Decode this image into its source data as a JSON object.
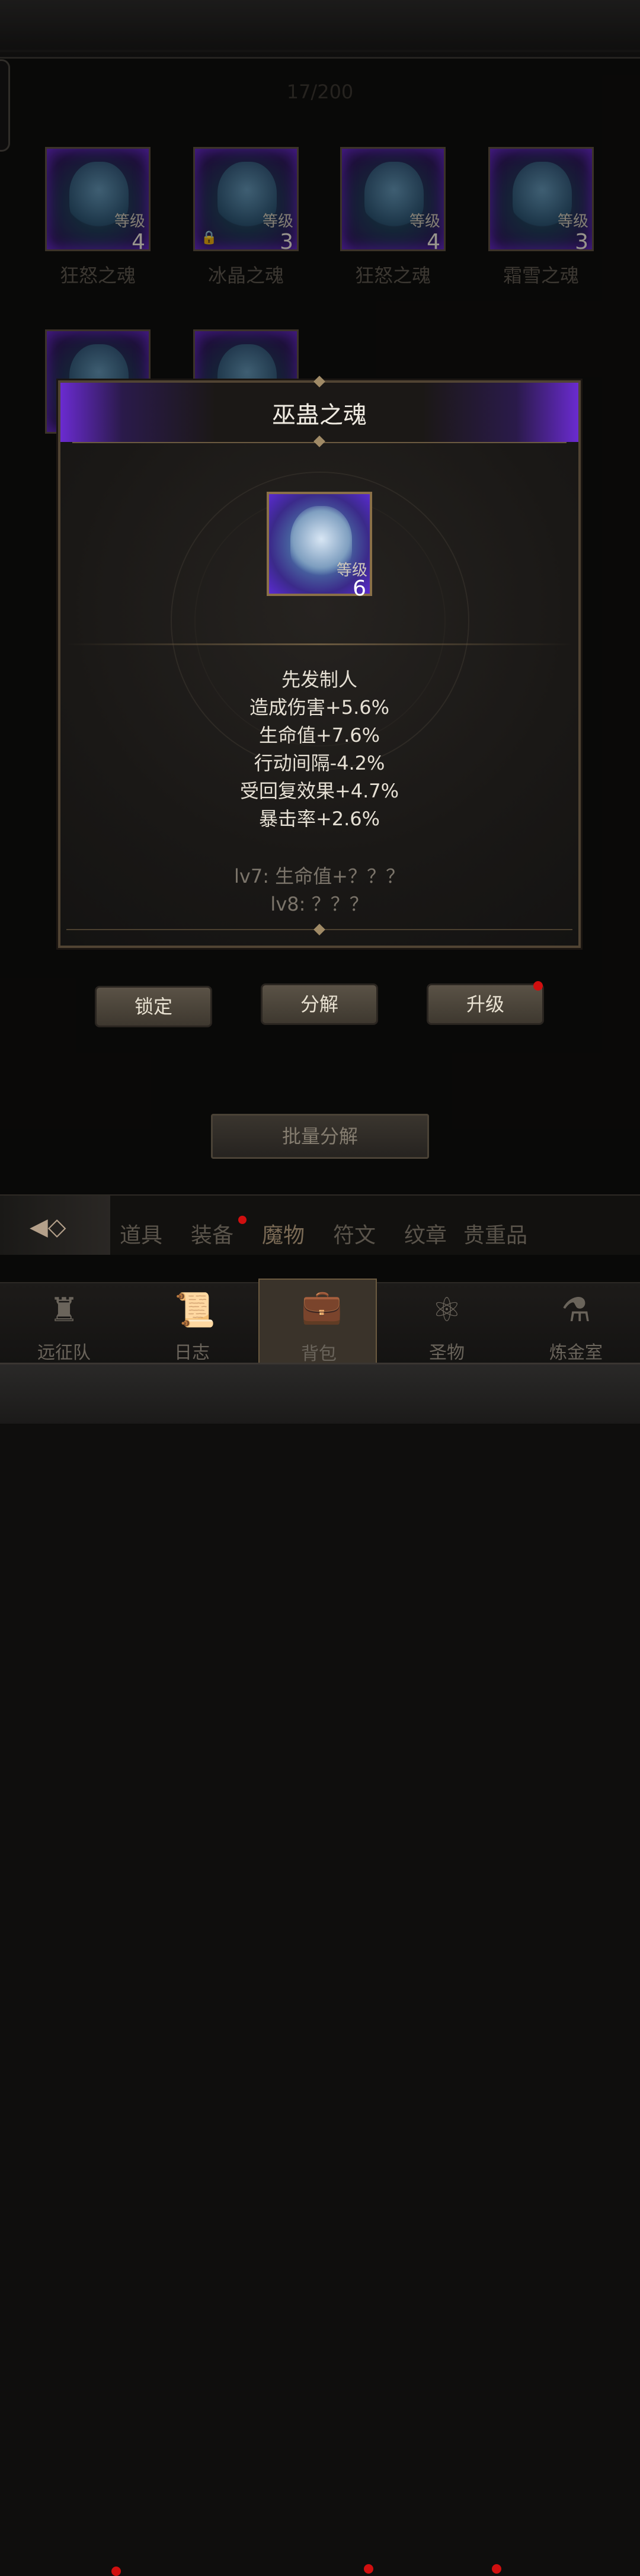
{
  "counter": "17/200",
  "grid": {
    "level_label": "等级",
    "slots": [
      {
        "name": "狂怒之魂",
        "level": "4",
        "locked": false
      },
      {
        "name": "冰晶之魂",
        "level": "3",
        "locked": true
      },
      {
        "name": "狂怒之魂",
        "level": "4",
        "locked": false
      },
      {
        "name": "霜雪之魂",
        "level": "3",
        "locked": false
      }
    ]
  },
  "popup": {
    "title": "巫蛊之魂",
    "level_label": "等级",
    "level": "6",
    "effects": [
      "先发制人",
      "造成伤害+5.6%",
      "生命值+7.6%",
      "行动间隔-4.2%",
      "受回复效果+4.7%",
      "暴击率+2.6%"
    ],
    "next_levels": [
      "lv7: 生命值+？？？",
      "lv8: ？？？"
    ]
  },
  "actions": {
    "lock": "锁定",
    "decompose": "分解",
    "upgrade": "升级"
  },
  "batch_decompose": "批量分解",
  "tabs": [
    "道具",
    "装备",
    "魔物",
    "符文",
    "纹章",
    "贵重品"
  ],
  "nav": [
    "远征队",
    "日志",
    "背包",
    "圣物",
    "炼金室"
  ],
  "colors": {
    "accent_purple": "#6a2bd0",
    "gold_border": "#8a7048",
    "notification": "#d00f0f"
  }
}
